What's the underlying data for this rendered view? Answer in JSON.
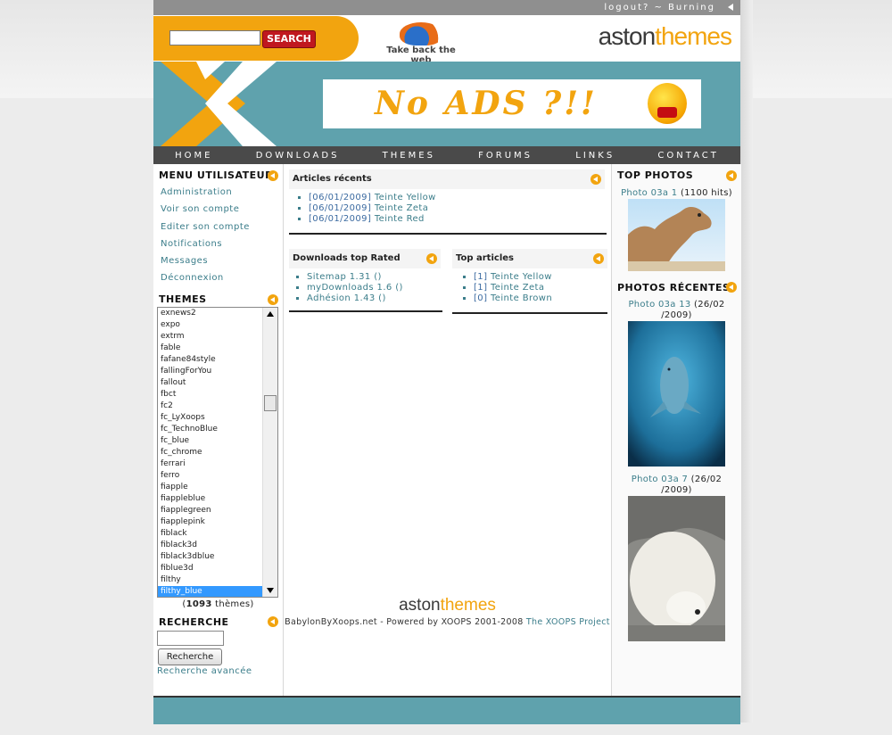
{
  "topbar": {
    "text": "logout? ~ Burning"
  },
  "header": {
    "search_button": "SEARCH",
    "tagline": "Take back the web",
    "brand_a": "aston",
    "brand_t": "themes"
  },
  "banner": {
    "ad_text": "No ADS ?!!"
  },
  "nav": [
    "HOME",
    "DOWNLOADS",
    "THEMES",
    "FORUMS",
    "LINKS",
    "CONTACT"
  ],
  "left": {
    "menu_title": "MENU UTILISATEUR",
    "menu": [
      "Administration",
      "Voir son compte",
      "Editer son compte",
      "Notifications",
      "Messages",
      "Déconnexion"
    ],
    "themes_title": "THEMES",
    "themes": [
      "exnews2",
      "expo",
      "extrm",
      "fable",
      "fafane84style",
      "fallingForYou",
      "fallout",
      "fbct",
      "fc2",
      "fc_LyXoops",
      "fc_TechnoBlue",
      "fc_blue",
      "fc_chrome",
      "ferrari",
      "ferro",
      "fiapple",
      "fiappleblue",
      "fiapplegreen",
      "fiapplepink",
      "fiblack",
      "fiblack3d",
      "fiblack3dblue",
      "fiblue3d",
      "filthy",
      "filthy_blue"
    ],
    "themes_selected": "filthy_blue",
    "themes_count_num": "1093",
    "themes_count_suffix": " thèmes)",
    "themes_count_prefix": "(",
    "search_title": "RECHERCHE",
    "search_button": "Recherche",
    "advanced_link": "Recherche avancée"
  },
  "center": {
    "recent_title": "Articles récents",
    "recent": [
      {
        "date": "[06/01/2009]",
        "title": "Teinte Yellow"
      },
      {
        "date": "[06/01/2009]",
        "title": "Teinte Zeta"
      },
      {
        "date": "[06/01/2009]",
        "title": "Teinte Red"
      }
    ],
    "downloads_title": "Downloads top Rated",
    "downloads": [
      "Sitemap 1.31 ()",
      "myDownloads 1.6 ()",
      "Adhésion 1.43 ()"
    ],
    "top_title": "Top articles",
    "top": [
      {
        "count": "[1]",
        "title": "Teinte Yellow"
      },
      {
        "count": "[1]",
        "title": "Teinte Zeta"
      },
      {
        "count": "[0]",
        "title": "Teinte Brown"
      }
    ],
    "footer_brand_a": "aston",
    "footer_brand_t": "themes",
    "footer_text": "BabylonByXoops.net - Powered by XOOPS 2001-2008",
    "footer_link": "The XOOPS Project"
  },
  "right": {
    "top_title": "TOP PHOTOS",
    "top_caption_link": "Photo 03a 1",
    "top_caption_rest": " (1100 hits)",
    "recent_title": "PHOTOS RÉCENTES",
    "photo1_link": "Photo 03a 13",
    "photo1_rest": " (26/02",
    "photo1_rest2": "/2009)",
    "photo2_link": "Photo 03a 7",
    "photo2_rest": " (26/02",
    "photo2_rest2": "/2009)"
  }
}
